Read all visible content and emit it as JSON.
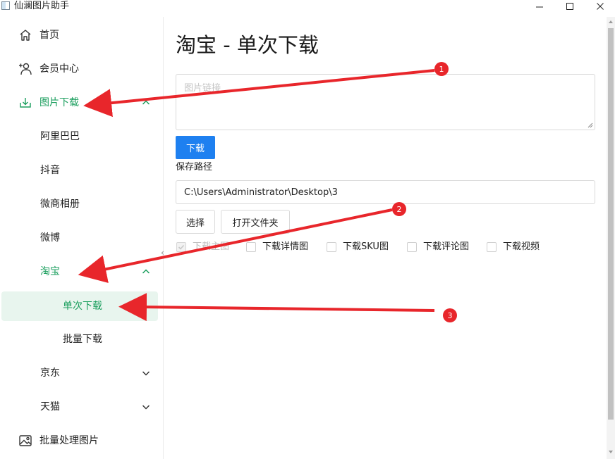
{
  "window": {
    "title": "仙澜图片助手"
  },
  "sidebar": {
    "items": [
      {
        "label": "首页",
        "icon": "home-icon"
      },
      {
        "label": "会员中心",
        "icon": "add-user-icon"
      },
      {
        "label": "图片下载",
        "icon": "download-icon",
        "expanded": true
      },
      {
        "label": "阿里巴巴"
      },
      {
        "label": "抖音"
      },
      {
        "label": "微商相册"
      },
      {
        "label": "微博"
      },
      {
        "label": "淘宝",
        "expanded": true
      },
      {
        "label": "单次下载",
        "selected": true
      },
      {
        "label": "批量下载"
      },
      {
        "label": "京东",
        "expanded": false
      },
      {
        "label": "天猫",
        "expanded": false
      },
      {
        "label": "批量处理图片",
        "icon": "image-icon"
      }
    ]
  },
  "main": {
    "title": "淘宝 - 单次下载",
    "url_placeholder": "图片链接",
    "download_button": "下载",
    "save_path_label": "保存路径",
    "save_path_value": "C:\\Users\\Administrator\\Desktop\\3",
    "choose_button": "选择",
    "open_folder_button": "打开文件夹",
    "options": [
      {
        "label": "下载主图",
        "checked": true,
        "disabled": true
      },
      {
        "label": "下载详情图",
        "checked": false
      },
      {
        "label": "下载SKU图",
        "checked": false
      },
      {
        "label": "下载评论图",
        "checked": false
      },
      {
        "label": "下载视频",
        "checked": false
      }
    ]
  },
  "annotations": {
    "markers": [
      "1",
      "2",
      "3"
    ],
    "color": "#e8262b"
  },
  "colors": {
    "accent_green": "#1a9e5d",
    "selected_bg": "#e8f5ee",
    "primary_blue": "#1e80f0"
  }
}
